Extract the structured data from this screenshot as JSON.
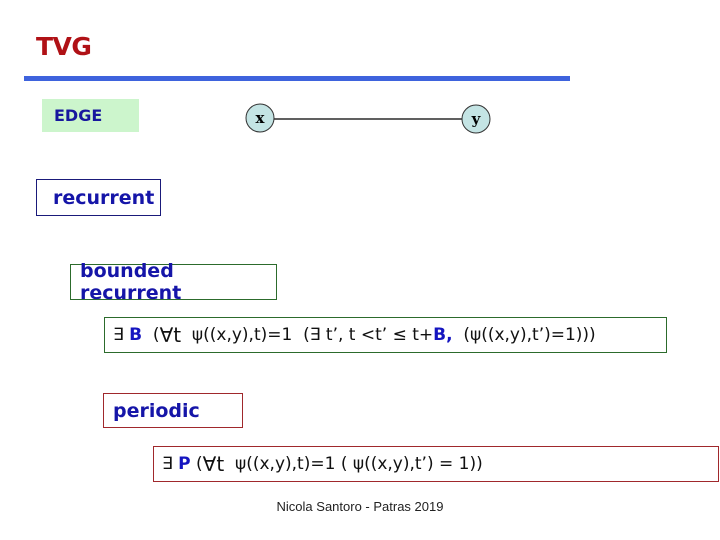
{
  "title": "TVG",
  "edge_label": "EDGE",
  "graph": {
    "nodes": [
      {
        "id": "x",
        "label": "x"
      },
      {
        "id": "y",
        "label": "y"
      }
    ],
    "edges": [
      {
        "from": "x",
        "to": "y"
      }
    ],
    "node_fill": "#c4e4e4"
  },
  "classes": {
    "recurrent": "recurrent",
    "bounded_recurrent": "bounded recurrent",
    "periodic": "periodic"
  },
  "formulas": {
    "bounded": {
      "exists": "∃ ",
      "var": "B",
      "part1": "  (",
      "forall": "∀t",
      "part2": "  ψ((x,y),t)=1  (∃ t’, t <t’ ≤ t+",
      "var2": "B,",
      "part3": "  (ψ((x,y),t’)=1)))"
    },
    "periodic": {
      "exists": "∃ ",
      "var": "P",
      "part1": " (",
      "forall": "∀t",
      "part2": "  ψ((x,y),t)=1 ( ψ((x,y),t’) = 1))"
    }
  },
  "footer": "Nicola Santoro - Patras 2019",
  "colors": {
    "title": "#b01116",
    "rule": "#3e63dd",
    "edge_box_bg": "#ccf5cc",
    "label_text": "#1515a8",
    "bounded_border": "#2c6b2c",
    "periodic_border": "#a0282c"
  }
}
